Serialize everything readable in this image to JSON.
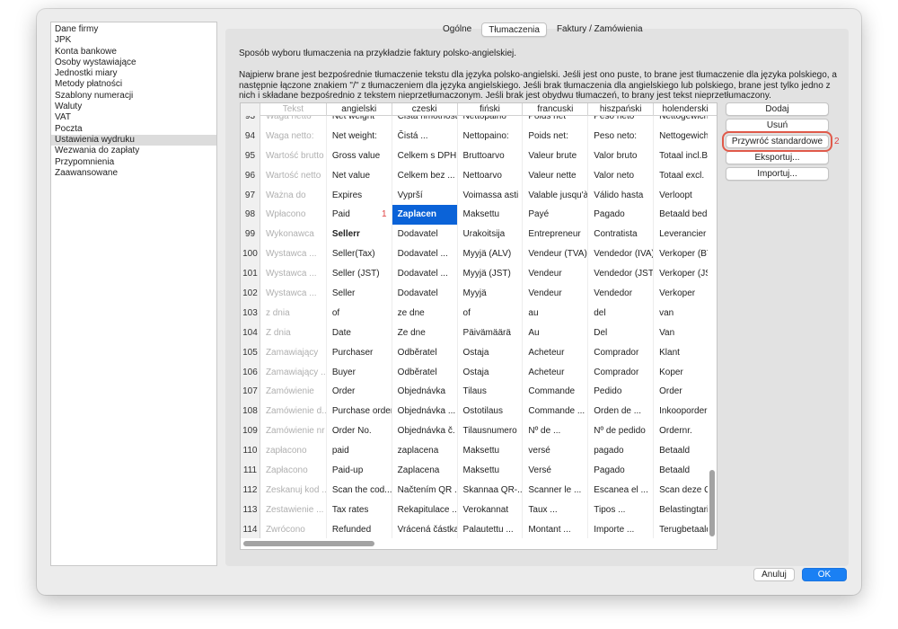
{
  "sidebar": {
    "items": [
      "Dane firmy",
      "JPK",
      "Konta bankowe",
      "Osoby wystawiające",
      "Jednostki miary",
      "Metody płatności",
      "Szablony numeracji",
      "Waluty",
      "VAT",
      "Poczta",
      "Ustawienia wydruku",
      "Wezwania do zapłaty",
      "Przypomnienia",
      "Zaawansowane"
    ],
    "selected": "Ustawienia wydruku"
  },
  "tabs": [
    "Ogólne",
    "Tłumaczenia",
    "Faktury / Zamówienia"
  ],
  "active_tab": "Tłumaczenia",
  "description": {
    "line1": "Sposób wyboru tłumaczenia na przykładzie faktury polsko-angielskiej.",
    "line2": "Najpierw brane jest bezpośrednie tłumaczenie tekstu dla języka polsko-angielski. Jeśli jest ono puste, to brane jest tłumaczenie dla języka polskiego, a następnie łączone znakiem \"/\" z tłumaczeniem dla języka angielskiego. Jeśli brak tłumaczenia dla angielskiego lub polskiego, brane jest tylko jedno z nich i składane bezpośrednio z tekstem nieprzetłumaczonym. Jeśli brak jest obydwu tłumaczeń, to brany jest tekst nieprzetłumaczony."
  },
  "table": {
    "headers": [
      "",
      "Tekst",
      "angielski",
      "czeski",
      "fiński",
      "francuski",
      "hiszpański",
      "holenderski"
    ],
    "rows": [
      [
        "93",
        "Waga netto",
        "Net weight",
        "Čistá hmotnost",
        "Nettopaino",
        "Poids net",
        "Peso neto",
        "Nettogewicht"
      ],
      [
        "94",
        "Waga netto:",
        "Net weight:",
        "Čistá ...",
        "Nettopaino:",
        "Poids net:",
        "Peso neto:",
        "Nettogewicht"
      ],
      [
        "95",
        "Wartość brutto",
        "Gross value",
        "Celkem s DPH",
        "Bruttoarvo",
        "Valeur brute",
        "Valor bruto",
        "Totaal incl.BT"
      ],
      [
        "96",
        "Wartość netto",
        "Net value",
        "Celkem bez ...",
        "Nettoarvo",
        "Valeur nette",
        "Valor neto",
        "Totaal excl."
      ],
      [
        "97",
        "Ważna do",
        "Expires",
        "Vyprší",
        "Voimassa asti",
        "Valable jusqu'à",
        "Válido hasta",
        "Verloopt"
      ],
      [
        "98",
        "Wpłacono",
        "Paid",
        "Zaplacen",
        "Maksettu",
        "Payé",
        "Pagado",
        "Betaald bedra"
      ],
      [
        "99",
        "Wykonawca",
        "Sellerr",
        "Dodavatel",
        "Urakoitsija",
        "Entrepreneur",
        "Contratista",
        "Leverancier"
      ],
      [
        "100",
        "Wystawca ...",
        "Seller(Tax)",
        "Dodavatel ...",
        "Myyjä (ALV)",
        "Vendeur (TVA)",
        "Vendedor (IVA)",
        "Verkoper (BTW"
      ],
      [
        "101",
        "Wystawca ...",
        "Seller (JST)",
        "Dodavatel ...",
        "Myyjä (JST)",
        "Vendeur",
        "Vendedor (JST)",
        "Verkoper (JST"
      ],
      [
        "102",
        "Wystawca ...",
        "Seller",
        "Dodavatel",
        "Myyjä",
        "Vendeur",
        "Vendedor",
        "Verkoper"
      ],
      [
        "103",
        "z dnia",
        "of",
        "ze dne",
        "of",
        "au",
        "del",
        "van"
      ],
      [
        "104",
        "Z dnia",
        "Date",
        "Ze dne",
        "Päivämäärä",
        "Au",
        "Del",
        "Van"
      ],
      [
        "105",
        "Zamawiający",
        "Purchaser",
        "Odběratel",
        "Ostaja",
        "Acheteur",
        "Comprador",
        "Klant"
      ],
      [
        "106",
        "Zamawiający ...",
        "Buyer",
        "Odběratel",
        "Ostaja",
        "Acheteur",
        "Comprador",
        "Koper"
      ],
      [
        "107",
        "Zamówienie",
        "Order",
        "Objednávka",
        "Tilaus",
        "Commande",
        "Pedido",
        "Order"
      ],
      [
        "108",
        "Zamówienie d...",
        "Purchase order",
        "Objednávka ...",
        "Ostotilaus",
        "Commande ...",
        "Orden de ...",
        "Inkooporder"
      ],
      [
        "109",
        "Zamówienie nr",
        "Order No.",
        "Objednávka č.",
        "Tilausnumero",
        "Nº de ...",
        "Nº de pedido",
        "Ordernr."
      ],
      [
        "110",
        "zapłacono",
        "paid",
        "zaplacena",
        "Maksettu",
        "versé",
        "pagado",
        "Betaald"
      ],
      [
        "111",
        "Zapłacono",
        "Paid-up",
        "Zaplacena",
        "Maksettu",
        "Versé",
        "Pagado",
        "Betaald"
      ],
      [
        "112",
        "Zeskanuj kod ...",
        "Scan the cod...",
        "Načtením QR ...",
        "Skannaa QR-...",
        "Scanner le ...",
        "Escanea el ...",
        "Scan deze QR"
      ],
      [
        "113",
        "Zestawienie ...",
        "Tax rates",
        "Rekapitulace ...",
        "Verokannat",
        "Taux ...",
        "Tipos ...",
        "Belastingtarie"
      ],
      [
        "114",
        "Zwrócono",
        "Refunded",
        "Vrácená částka",
        "Palautettu ...",
        "Montant ...",
        "Importe ...",
        "Terugbetaald"
      ]
    ]
  },
  "annotations": {
    "marker1": "1",
    "marker2": "2"
  },
  "buttons": {
    "add": "Dodaj",
    "remove": "Usuń",
    "restore_defaults": "Przywróć standardowe",
    "export": "Eksportuj...",
    "import": "Importuj..."
  },
  "footer": {
    "cancel": "Anuluj",
    "ok": "OK"
  },
  "colors": {
    "selection": "#0b63d8",
    "ok_button": "#1a80f4",
    "annotation": "#e04040"
  }
}
